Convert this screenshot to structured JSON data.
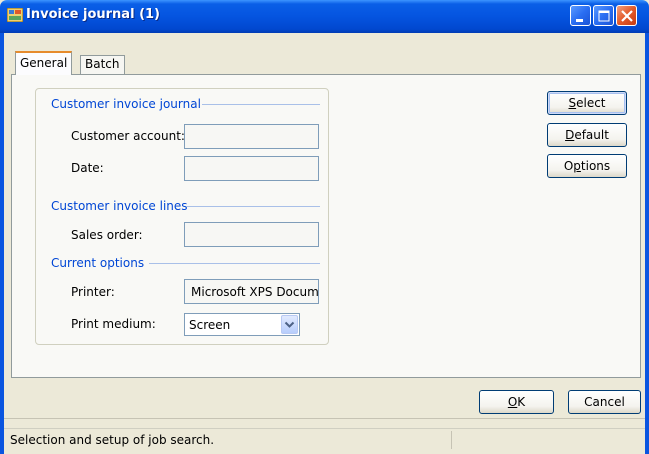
{
  "window": {
    "title": "Invoice journal (1)",
    "accent_color": "#0554e0",
    "controls": [
      "minimize-icon",
      "maximize-icon",
      "close-icon"
    ]
  },
  "tabs": [
    {
      "label": "General",
      "active": true
    },
    {
      "label": "Batch",
      "active": false
    }
  ],
  "sections": {
    "invoice_journal": "Customer invoice journal",
    "invoice_lines": "Customer invoice lines",
    "current_options": "Current options"
  },
  "fields": {
    "customer_account": {
      "label": "Customer account:",
      "value": ""
    },
    "date": {
      "label": "Date:",
      "value": ""
    },
    "sales_order": {
      "label": "Sales order:",
      "value": ""
    },
    "printer": {
      "label": "Printer:",
      "value": "Microsoft XPS Docume"
    },
    "print_medium": {
      "label": "Print medium:",
      "value": "Screen"
    }
  },
  "side_buttons": {
    "select": {
      "accel": "S",
      "rest": "elect"
    },
    "default": {
      "accel": "D",
      "rest": "efault"
    },
    "options": {
      "pre": "O",
      "accel": "p",
      "rest": "tions"
    }
  },
  "footer_buttons": {
    "ok": {
      "accel": "O",
      "rest": "K"
    },
    "cancel": "Cancel"
  },
  "status_bar": {
    "text": "Selection and setup of job search."
  }
}
